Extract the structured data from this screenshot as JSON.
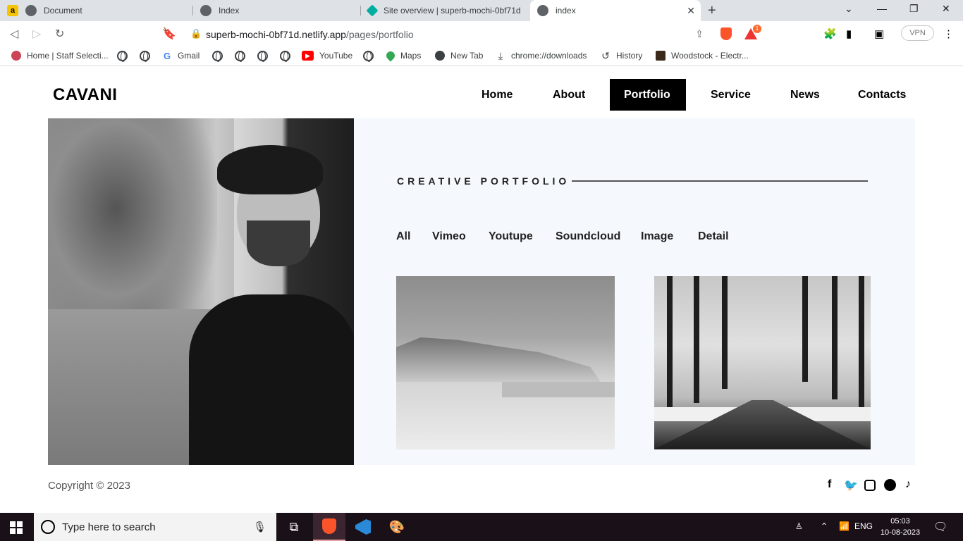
{
  "browser": {
    "tabs": [
      {
        "title": "Document",
        "favicon": "a"
      },
      {
        "title": "Index"
      },
      {
        "title": "Site overview | superb-mochi-0bf71d"
      },
      {
        "title": "index"
      }
    ],
    "url_host": "superb-mochi-0bf71d.netlify.app",
    "url_path": "/pages/portfolio",
    "vpn_label": "VPN",
    "notification_badge": "1",
    "bookmarks": [
      {
        "label": "Home | Staff Selecti..."
      },
      {
        "label": "Gmail"
      },
      {
        "label": "YouTube"
      },
      {
        "label": "Maps"
      },
      {
        "label": "New Tab"
      },
      {
        "label": "chrome://downloads"
      },
      {
        "label": "History"
      },
      {
        "label": "Woodstock - Electr..."
      }
    ]
  },
  "site": {
    "logo": "CAVANI",
    "nav": [
      {
        "label": "Home"
      },
      {
        "label": "About"
      },
      {
        "label": "Portfolio",
        "active": true
      },
      {
        "label": "Service"
      },
      {
        "label": "News"
      },
      {
        "label": "Contacts"
      }
    ],
    "section_title": "CREATIVE PORTFOLIO",
    "filters": [
      "All",
      "Vimeo",
      "Youtupe",
      "Soundcloud",
      "Image",
      "Detail"
    ],
    "copyright": "Copyright © 2023",
    "social_icons": [
      "facebook-icon",
      "twitter-icon",
      "instagram-icon",
      "dribbble-icon",
      "tiktok-icon"
    ],
    "colors": {
      "accent": "#000000",
      "panel_bg": "#f5f9fd"
    }
  },
  "taskbar": {
    "search_placeholder": "Type here to search",
    "language": "ENG",
    "time": "05:03",
    "date": "10-08-2023"
  }
}
